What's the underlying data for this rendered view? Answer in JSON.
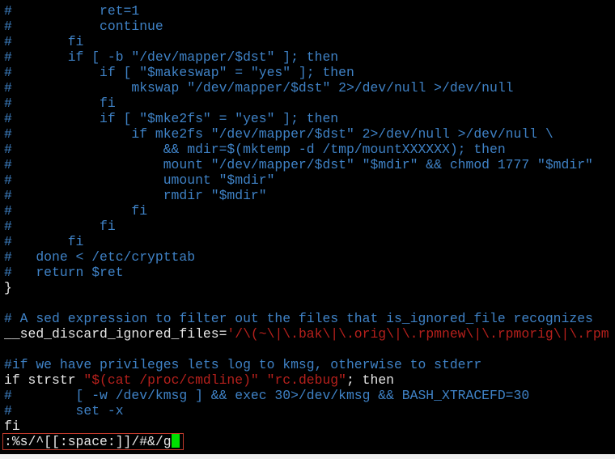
{
  "colors": {
    "background": "#000000",
    "comment": "#3f82c6",
    "string": "#b5201c",
    "text": "#e6e6e6",
    "cursor": "#00e000",
    "highlight_box": "#c0392b"
  },
  "lines": [
    [
      {
        "t": "#           ret=1",
        "c": "comment"
      }
    ],
    [
      {
        "t": "#           continue",
        "c": "comment"
      }
    ],
    [
      {
        "t": "#       fi",
        "c": "comment"
      }
    ],
    [
      {
        "t": "#       if [ -b \"/dev/mapper/$dst\" ]; then",
        "c": "comment"
      }
    ],
    [
      {
        "t": "#           if [ \"$makeswap\" = \"yes\" ]; then",
        "c": "comment"
      }
    ],
    [
      {
        "t": "#               mkswap \"/dev/mapper/$dst\" 2>/dev/null >/dev/null",
        "c": "comment"
      }
    ],
    [
      {
        "t": "#           fi",
        "c": "comment"
      }
    ],
    [
      {
        "t": "#           if [ \"$mke2fs\" = \"yes\" ]; then",
        "c": "comment"
      }
    ],
    [
      {
        "t": "#               if mke2fs \"/dev/mapper/$dst\" 2>/dev/null >/dev/null \\",
        "c": "comment"
      }
    ],
    [
      {
        "t": "#                   && mdir=$(mktemp -d /tmp/mountXXXXXX); then",
        "c": "comment"
      }
    ],
    [
      {
        "t": "#                   mount \"/dev/mapper/$dst\" \"$mdir\" && chmod 1777 \"$mdir\"",
        "c": "comment"
      }
    ],
    [
      {
        "t": "#                   umount \"$mdir\"",
        "c": "comment"
      }
    ],
    [
      {
        "t": "#                   rmdir \"$mdir\"",
        "c": "comment"
      }
    ],
    [
      {
        "t": "#               fi",
        "c": "comment"
      }
    ],
    [
      {
        "t": "#           fi",
        "c": "comment"
      }
    ],
    [
      {
        "t": "#       fi",
        "c": "comment"
      }
    ],
    [
      {
        "t": "#   done < /etc/crypttab",
        "c": "comment"
      }
    ],
    [
      {
        "t": "#   return $ret",
        "c": "comment"
      }
    ],
    [
      {
        "t": "}",
        "c": "normal"
      }
    ],
    [],
    [
      {
        "t": "# A sed expression to filter out the files that is_ignored_file recognizes",
        "c": "comment"
      }
    ],
    [
      {
        "t": "__sed_discard_ignored_files=",
        "c": "normal"
      },
      {
        "t": "'/\\(~\\|\\.bak\\|\\.orig\\|\\.rpmnew\\|\\.rpmorig\\|\\.rpm",
        "c": "string"
      }
    ],
    [],
    [
      {
        "t": "#if we have privileges lets log to kmsg, otherwise to stderr",
        "c": "comment"
      }
    ],
    [
      {
        "t": "if strstr ",
        "c": "normal"
      },
      {
        "t": "\"$(cat /proc/cmdline)\" \"rc.debug\"",
        "c": "string"
      },
      {
        "t": "; then",
        "c": "normal"
      }
    ],
    [
      {
        "t": "#        [ -w /dev/kmsg ] && exec 30>/dev/kmsg && BASH_XTRACEFD=30",
        "c": "comment"
      }
    ],
    [
      {
        "t": "#        set -x",
        "c": "comment"
      }
    ],
    [
      {
        "t": "fi",
        "c": "normal"
      }
    ]
  ],
  "command_line": ":%s/^[[:space:]]/#&/g"
}
